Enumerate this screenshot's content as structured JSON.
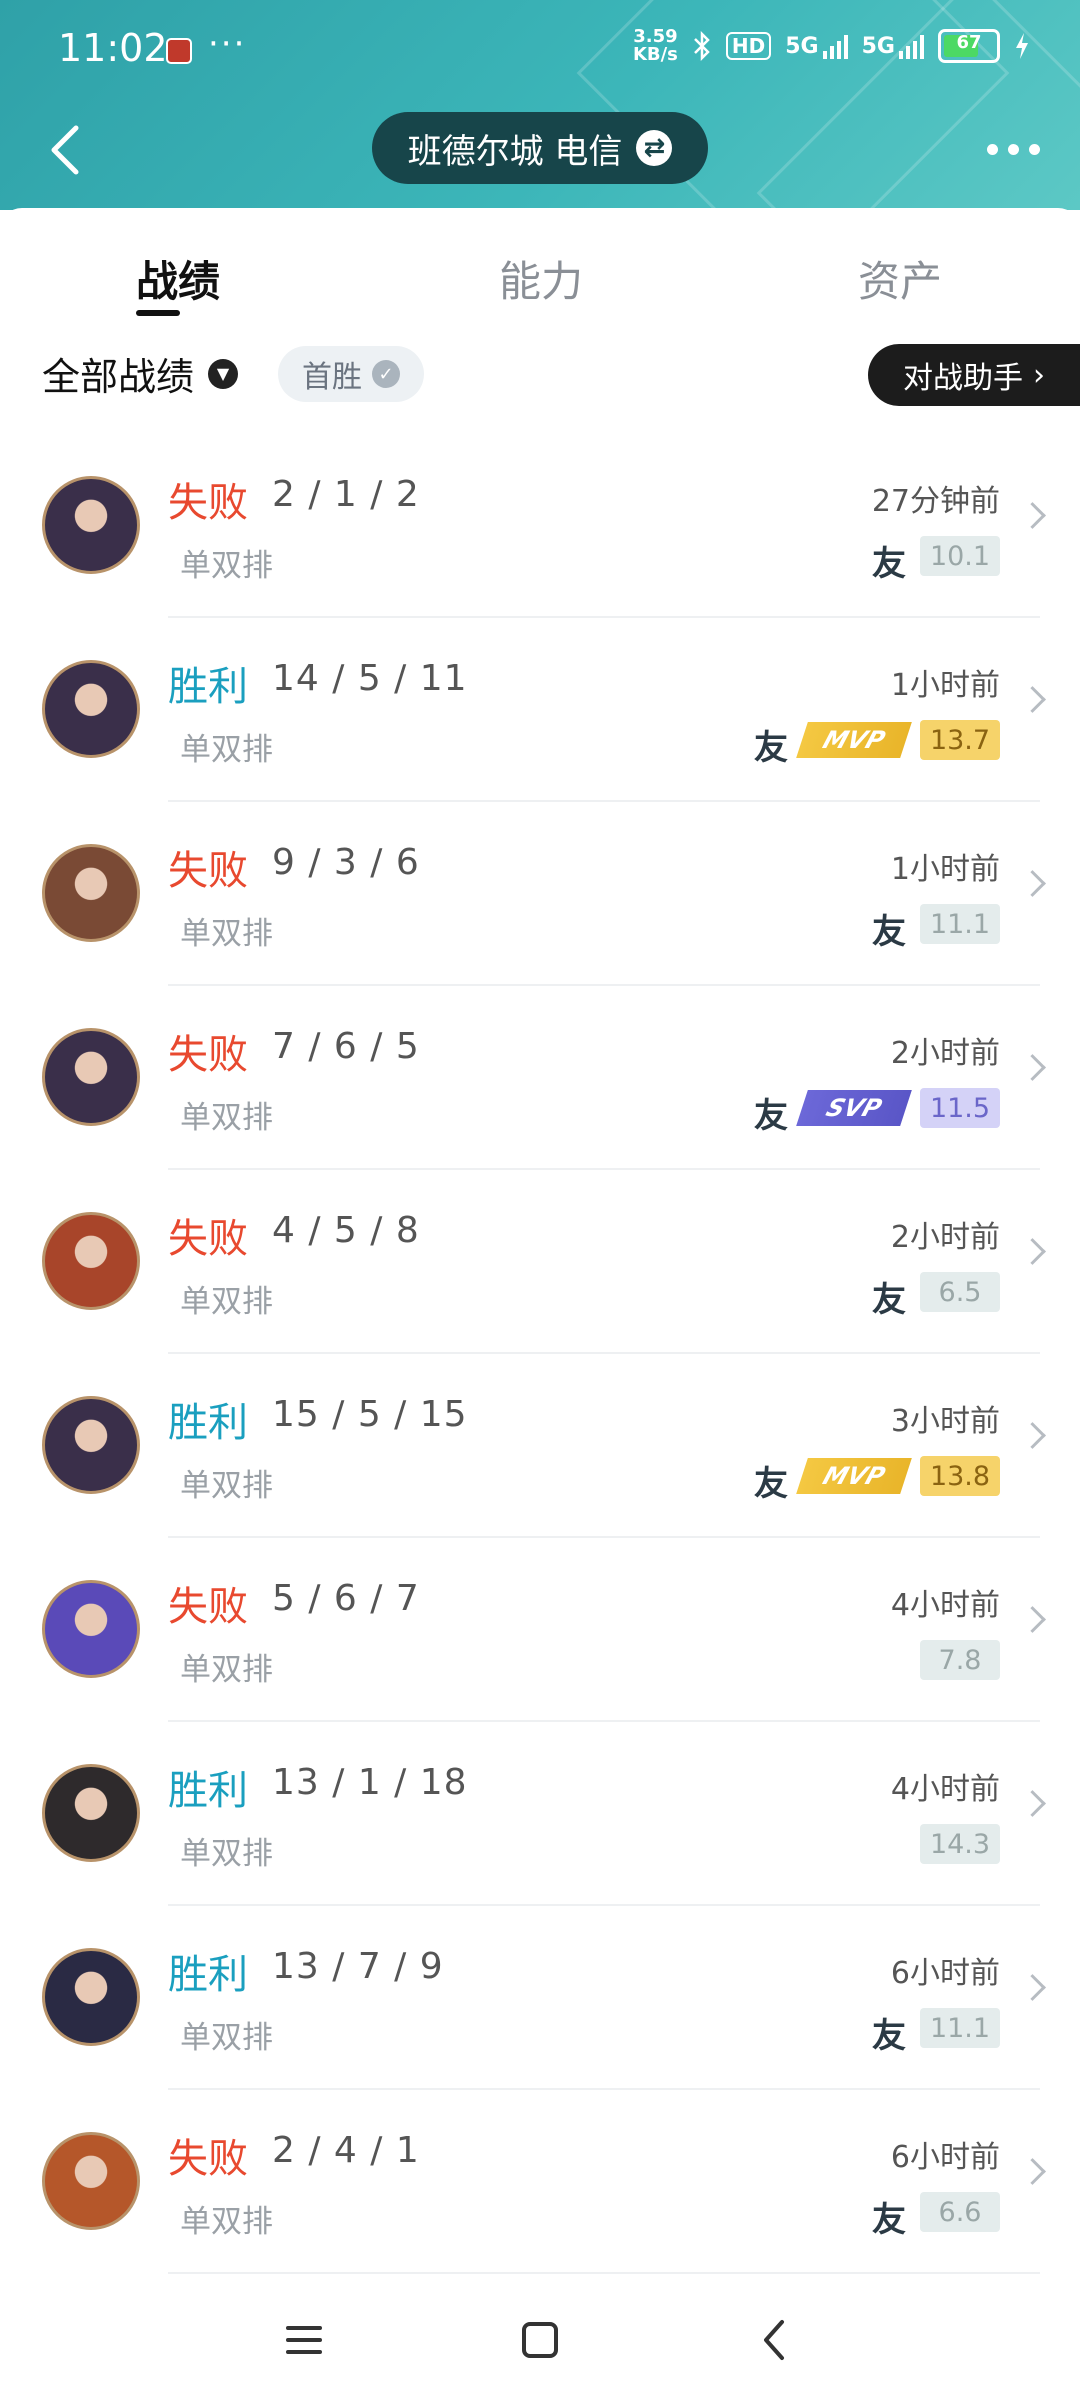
{
  "status_bar": {
    "time": "11:02",
    "dots": "···",
    "speed_top": "3.59",
    "speed_bottom": "KB/s",
    "hd": "HD",
    "net1": "5G",
    "net2": "5G",
    "battery": "67"
  },
  "header": {
    "region": "班德尔城 电信",
    "swap_symbol": "⇄"
  },
  "tabs": [
    {
      "label": "战绩",
      "active": true
    },
    {
      "label": "能力",
      "active": false
    },
    {
      "label": "资产",
      "active": false
    }
  ],
  "filter": {
    "all_label": "全部战绩",
    "first_win_label": "首胜",
    "assist_label": "对战助手",
    "assist_arrow": "›"
  },
  "matches": [
    {
      "result": "失败",
      "kda": "2 / 1 / 2",
      "mode": "单双排",
      "time": "27分钟前",
      "score": "10.1",
      "friend": "友",
      "badge": "",
      "outcome": "lose",
      "grade": "normal"
    },
    {
      "result": "胜利",
      "kda": "14 / 5 / 11",
      "mode": "单双排",
      "time": "1小时前",
      "score": "13.7",
      "friend": "友",
      "badge": "MVP",
      "outcome": "win",
      "grade": "mvp"
    },
    {
      "result": "失败",
      "kda": "9 / 3 / 6",
      "mode": "单双排",
      "time": "1小时前",
      "score": "11.1",
      "friend": "友",
      "badge": "",
      "outcome": "lose",
      "grade": "normal"
    },
    {
      "result": "失败",
      "kda": "7 / 6 / 5",
      "mode": "单双排",
      "time": "2小时前",
      "score": "11.5",
      "friend": "友",
      "badge": "SVP",
      "outcome": "lose",
      "grade": "svp"
    },
    {
      "result": "失败",
      "kda": "4 / 5 / 8",
      "mode": "单双排",
      "time": "2小时前",
      "score": "6.5",
      "friend": "友",
      "badge": "",
      "outcome": "lose",
      "grade": "normal"
    },
    {
      "result": "胜利",
      "kda": "15 / 5 / 15",
      "mode": "单双排",
      "time": "3小时前",
      "score": "13.8",
      "friend": "友",
      "badge": "MVP",
      "outcome": "win",
      "grade": "mvp"
    },
    {
      "result": "失败",
      "kda": "5 / 6 / 7",
      "mode": "单双排",
      "time": "4小时前",
      "score": "7.8",
      "friend": "",
      "badge": "",
      "outcome": "lose",
      "grade": "normal"
    },
    {
      "result": "胜利",
      "kda": "13 / 1 / 18",
      "mode": "单双排",
      "time": "4小时前",
      "score": "14.3",
      "friend": "",
      "badge": "",
      "outcome": "win",
      "grade": "normal"
    },
    {
      "result": "胜利",
      "kda": "13 / 7 / 9",
      "mode": "单双排",
      "time": "6小时前",
      "score": "11.1",
      "friend": "友",
      "badge": "",
      "outcome": "win",
      "grade": "normal"
    },
    {
      "result": "失败",
      "kda": "2 / 4 / 1",
      "mode": "单双排",
      "time": "6小时前",
      "score": "6.6",
      "friend": "友",
      "badge": "",
      "outcome": "lose",
      "grade": "normal"
    }
  ],
  "colors": {
    "header_teal": "#3cb6b9",
    "win": "#1a9fbf",
    "lose": "#e8492f",
    "avatar_palette": [
      "#3a2f4a",
      "#3a2f4a",
      "#7a4a35",
      "#3a2f4a",
      "#a8452a",
      "#3a2f4a",
      "#5a4ab8",
      "#2e2a2c",
      "#2a2a44",
      "#b5572a"
    ]
  }
}
